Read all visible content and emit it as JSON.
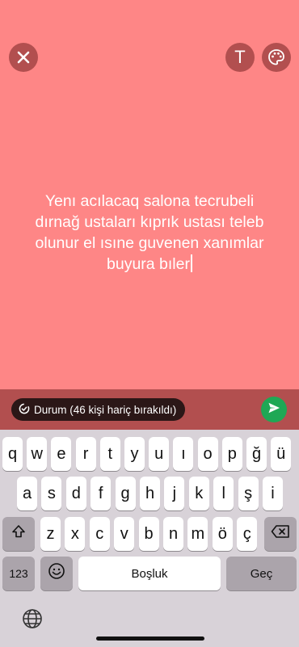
{
  "top_bar": {
    "close_icon": "close-icon",
    "text_icon_label": "T",
    "palette_icon": "palette-icon"
  },
  "status": {
    "text": "Yenı acılacaq salona tecrubeli dırnağ ustaları kıprık ustası teleb olunur el ısıne guvenen xanımlar buyura bıler",
    "background_color": "#fe8686"
  },
  "composer": {
    "audience_label": "Durum (46 kişi hariç bırakıldı)",
    "send_icon": "send-icon",
    "accent": "#1fa855"
  },
  "keyboard": {
    "row1": [
      "q",
      "w",
      "e",
      "r",
      "t",
      "y",
      "u",
      "ı",
      "o",
      "p",
      "ğ",
      "ü"
    ],
    "row2": [
      "a",
      "s",
      "d",
      "f",
      "g",
      "h",
      "j",
      "k",
      "l",
      "ş",
      "i"
    ],
    "row3": [
      "z",
      "x",
      "c",
      "v",
      "b",
      "n",
      "m",
      "ö",
      "ç"
    ],
    "numbers_label": "123",
    "space_label": "Boşluk",
    "return_label": "Geç",
    "shift_icon": "shift-icon",
    "backspace_icon": "backspace-icon",
    "emoji_icon": "emoji-icon",
    "globe_icon": "globe-icon"
  }
}
